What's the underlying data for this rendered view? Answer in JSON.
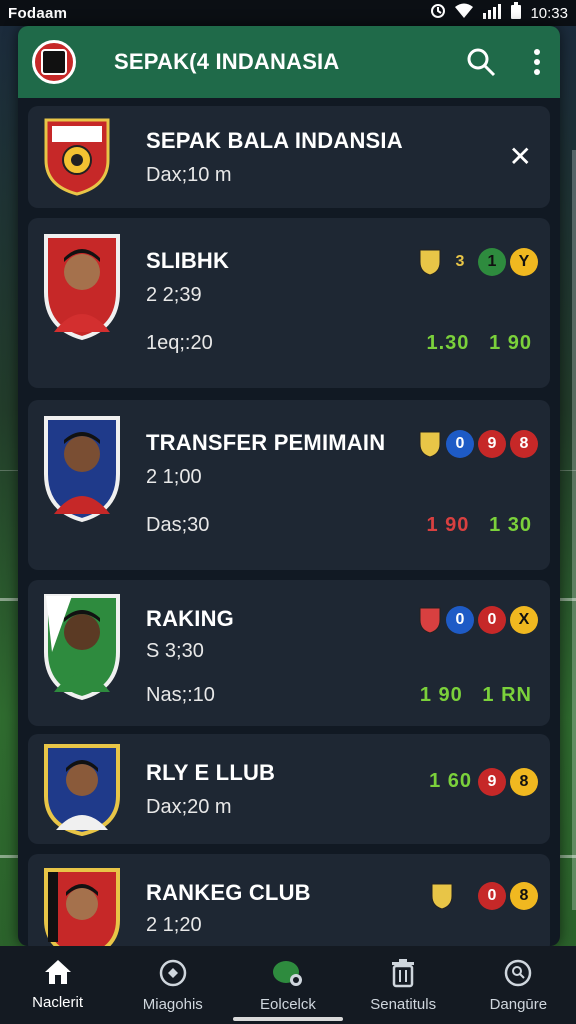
{
  "status_bar": {
    "left_text": "Fodaam",
    "time": "10:3",
    "time_suffix": "3"
  },
  "app": {
    "title": "SEPAK(4 INDANASIA",
    "actions": [
      "search-icon",
      "more-vert-icon"
    ]
  },
  "cards": [
    {
      "title": "SEPAK BALA  INDANSIA",
      "sub": "Dax;10 m",
      "close": "✕"
    },
    {
      "title": "SLIBHK",
      "sub": "2 2;39",
      "meta": "1eq;:20",
      "dots": [
        "3",
        "1",
        "Y"
      ],
      "score_a": "1.30",
      "score_b": "1 90"
    },
    {
      "title": "TRANSFER PEMIMAIN",
      "sub": "2 1;00",
      "meta": "Das;30",
      "dots": [
        "0",
        "9",
        "8"
      ],
      "score_a": "1 90",
      "score_b": "1 30"
    },
    {
      "title": "RAKING",
      "sub": "S 3;30",
      "meta": "Nas;:10",
      "dots": [
        "0",
        "0",
        "X"
      ],
      "score_a": "1 90",
      "score_b": "1 RN"
    },
    {
      "title": "RLY E LLUB",
      "sub": "Dax;20 m",
      "dots": [
        "9",
        "8"
      ],
      "score_a": "1 60"
    },
    {
      "title": "RANKEG CLUB",
      "sub": "2 1;20",
      "dots": [
        "0",
        "8"
      ]
    }
  ],
  "nav": {
    "items": [
      {
        "label": "Naclerit",
        "icon": "home-icon"
      },
      {
        "label": "Miagohis",
        "icon": "ball-icon"
      },
      {
        "label": "Eolcelck",
        "icon": "chat-icon"
      },
      {
        "label": "Senatituls",
        "icon": "trash-icon"
      },
      {
        "label": "Dangūre",
        "icon": "search-circle-icon"
      }
    ]
  },
  "colors": {
    "appbar": "#1f6a49",
    "card": "#1e2733",
    "score_green": "#7bd13b",
    "score_red": "#d84040"
  }
}
